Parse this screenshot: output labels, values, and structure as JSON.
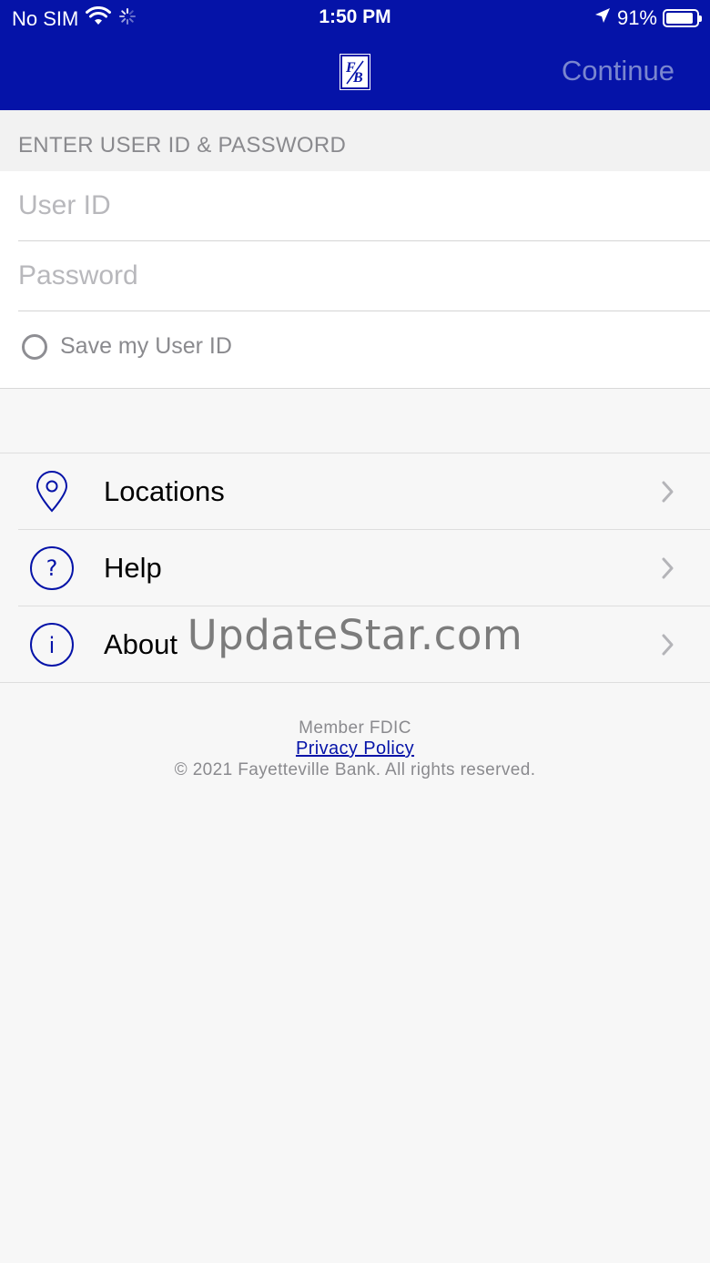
{
  "status_bar": {
    "carrier": "No SIM",
    "time": "1:50 PM",
    "battery": "91%",
    "battery_level": 0.91
  },
  "nav": {
    "continue_label": "Continue",
    "logo_icon": "fayetteville-bank-logo-icon"
  },
  "login": {
    "section_title": "ENTER USER ID & PASSWORD",
    "user_id_placeholder": "User ID",
    "password_placeholder": "Password",
    "save_user_id_label": "Save my User ID"
  },
  "menu": {
    "items": [
      {
        "label": "Locations",
        "icon": "location-pin-icon"
      },
      {
        "label": "Help",
        "icon": "question-circle-icon"
      },
      {
        "label": "About",
        "icon": "info-circle-icon"
      }
    ]
  },
  "watermark": "UpdateStar.com",
  "footer": {
    "member": "Member FDIC",
    "privacy_link": "Privacy Policy",
    "copyright": "© 2021 Fayetteville Bank. All rights reserved."
  },
  "colors": {
    "brand_blue": "#0513a8",
    "continue_disabled": "#7a86cf",
    "placeholder_gray": "#b8b8bc",
    "background": "#f7f7f7"
  }
}
